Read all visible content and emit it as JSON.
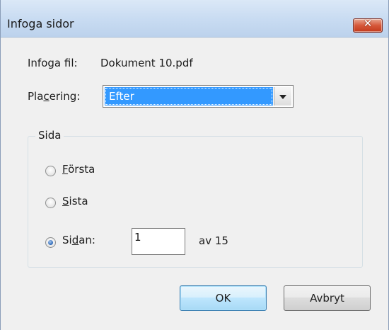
{
  "window": {
    "title": "Infoga sidor",
    "close_label": "✕"
  },
  "file": {
    "label": "Infoga fil:",
    "value": "Dokument 10.pdf"
  },
  "placement": {
    "label_before": "Pla",
    "label_mnemonic": "c",
    "label_after": "ering:",
    "selected": "Efter"
  },
  "page_group": {
    "title": "Sida",
    "options": [
      {
        "mnemonic": "F",
        "rest": "örsta",
        "checked": false
      },
      {
        "mnemonic": "S",
        "rest": "ista",
        "checked": false
      },
      {
        "before": "Si",
        "mnemonic": "d",
        "rest": "an:",
        "checked": true
      }
    ],
    "page_value": "1",
    "of_text": "av 15"
  },
  "buttons": {
    "ok": "OK",
    "cancel": "Avbryt"
  }
}
